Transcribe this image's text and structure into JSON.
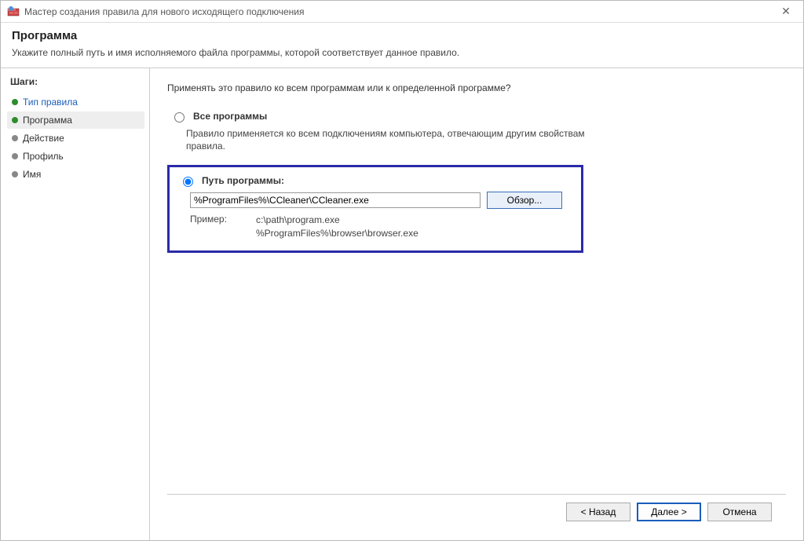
{
  "titlebar": {
    "title": "Мастер создания правила для нового исходящего подключения"
  },
  "header": {
    "heading": "Программа",
    "description": "Укажите полный путь и имя исполняемого файла программы, которой соответствует данное правило."
  },
  "sidebar": {
    "steps_title": "Шаги:",
    "items": [
      {
        "label": "Тип правила"
      },
      {
        "label": "Программа"
      },
      {
        "label": "Действие"
      },
      {
        "label": "Профиль"
      },
      {
        "label": "Имя"
      }
    ]
  },
  "content": {
    "prompt": "Применять это правило ко всем программам или к определенной программе?",
    "option_all": {
      "label": "Все программы",
      "desc": "Правило применяется ко всем подключениям компьютера, отвечающим другим свойствам правила."
    },
    "option_path": {
      "label": "Путь программы:",
      "value": "%ProgramFiles%\\CCleaner\\CCleaner.exe",
      "browse": "Обзор...",
      "example_label": "Пример:",
      "example_line1": "c:\\path\\program.exe",
      "example_line2": "%ProgramFiles%\\browser\\browser.exe"
    }
  },
  "footer": {
    "back": "< Назад",
    "next": "Далее >",
    "cancel": "Отмена"
  }
}
